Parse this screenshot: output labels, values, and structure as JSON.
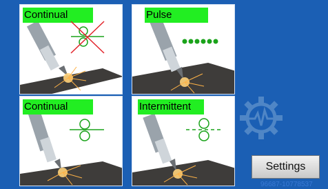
{
  "tiles": [
    {
      "label": "Continual",
      "mode_icon": "continual-crossed-icon"
    },
    {
      "label": "Pulse",
      "mode_icon": "pulse-dots-icon"
    },
    {
      "label": "Continual",
      "mode_icon": "continual-icon"
    },
    {
      "label": "Intermittent",
      "mode_icon": "intermittent-icon"
    }
  ],
  "gear_icon": "gear-waveform-icon",
  "settings_button": {
    "label": "Settings"
  },
  "serial": "96687-10778537",
  "colors": {
    "background": "#1b5fb4",
    "label_green": "#22ee22",
    "icon_green": "#1aa31a",
    "cross_red": "#e2232a",
    "gear": "#4f86c6"
  }
}
